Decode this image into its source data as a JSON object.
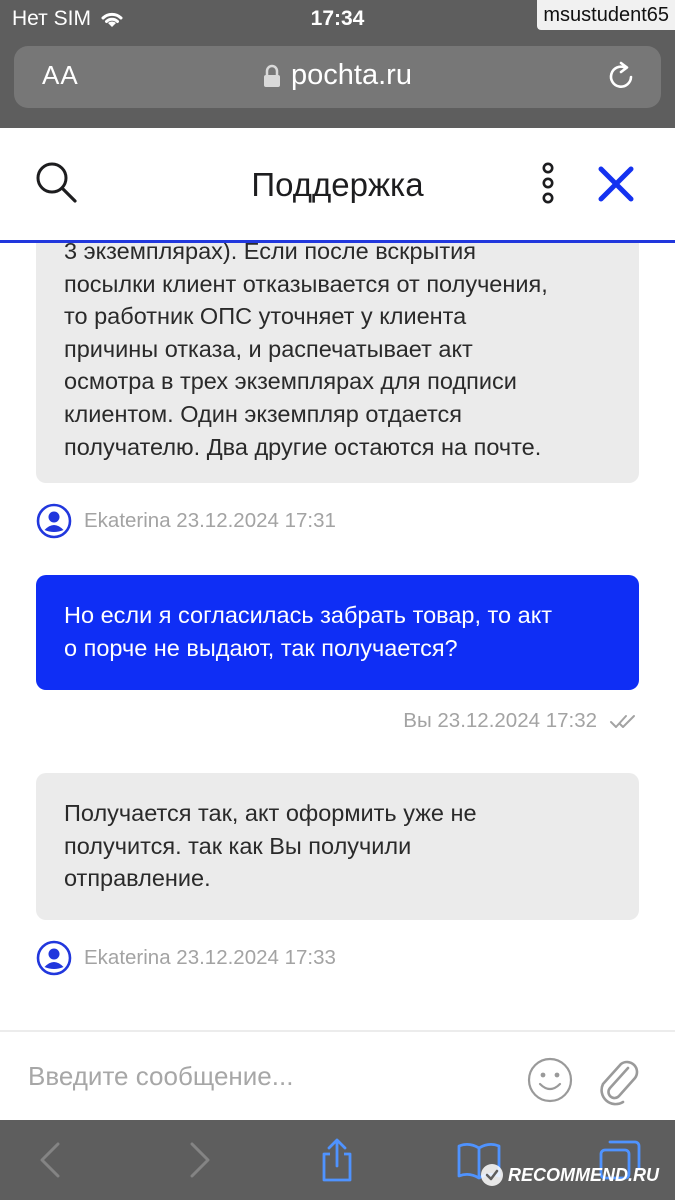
{
  "status_bar": {
    "carrier": "Нет SIM",
    "time": "17:34",
    "user_tag": "msustudent65"
  },
  "browser": {
    "text_size_label": "AA",
    "url": "pochta.ru"
  },
  "header": {
    "title": "Поддержка"
  },
  "messages": [
    {
      "direction": "incoming",
      "text": "3 экземплярах). Если после вскрытия\nпосылки клиент отказывается от получения,\nто работник ОПС уточняет у клиента\nпричины отказа, и распечатывает акт\nосмотра в трех экземплярах для подписи\nклиентом. Один экземпляр отдается\nполучателю. Два другие остаются на почте.",
      "meta": "Ekaterina 23.12.2024 17:31"
    },
    {
      "direction": "outgoing",
      "text": "Но если я согласилась забрать товар, то акт\nо порче не выдают, так получается?",
      "meta": "Вы 23.12.2024 17:32"
    },
    {
      "direction": "incoming",
      "text": "Получается так, акт оформить уже не\nполучится. так как Вы получили\nотправление.",
      "meta": "Ekaterina 23.12.2024 17:33"
    }
  ],
  "composer": {
    "placeholder": "Введите сообщение..."
  },
  "watermark": {
    "site": "RECOMMEND.RU"
  },
  "colors": {
    "accent": "#0f2ef5",
    "header_line": "#2137dd",
    "incoming_bubble": "#ebebeb",
    "safari_chrome": "#5e5e5e"
  },
  "icons": [
    "wifi-icon",
    "lock-icon",
    "reload-icon",
    "search-icon",
    "more-vertical-icon",
    "close-icon",
    "avatar-icon",
    "double-check-icon",
    "emoji-icon",
    "paperclip-icon",
    "back-icon",
    "forward-icon",
    "share-icon",
    "bookmarks-icon",
    "tabs-icon"
  ]
}
